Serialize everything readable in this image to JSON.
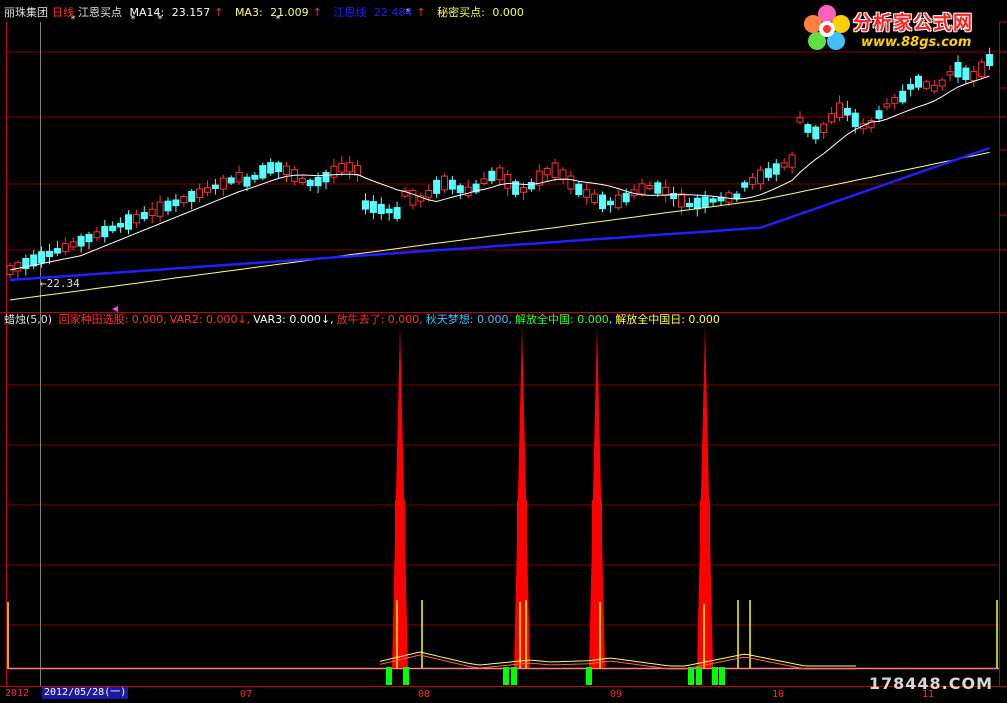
{
  "header": {
    "stock_name": "丽珠集团",
    "period": "日线",
    "indicator": "江恩买点",
    "ma14_label": "MA14:",
    "ma14_value": "23.157",
    "ma14_arrow": "↑",
    "ma3_label": "MA3:",
    "ma3_value": "21.009",
    "ma3_arrow": "↑",
    "gann_label": "江恩线",
    "gann_value": "22.484",
    "gann_arrow": "↑",
    "secret_label": "秘密买点:",
    "secret_value": "0.000"
  },
  "price_panel": {
    "low_marker": "←22.34"
  },
  "sub_panel": {
    "name": "蜡烛(5,0)",
    "items": [
      {
        "label": "回家种田选股:",
        "value": "0.000,",
        "color": "#ff3030"
      },
      {
        "label": "VAR2:",
        "value": "0.000↓,",
        "color": "#ff3030"
      },
      {
        "label": "VAR3:",
        "value": "0.000↓,",
        "color": "#ffffff"
      },
      {
        "label": "放牛去了:",
        "value": "0.000,",
        "color": "#ff3030"
      },
      {
        "label": "秋天梦想:",
        "value": "0.000,",
        "color": "#40c0ff"
      },
      {
        "label": "解放全中国:",
        "value": "0.000,",
        "color": "#30ff30"
      },
      {
        "label": "解放全中国日:",
        "value": "0.000",
        "color": "#ffff40"
      }
    ]
  },
  "timeline": {
    "year_label": "2012",
    "date_box": "2012/05/28(一)",
    "months": [
      "07",
      "08",
      "09",
      "10",
      "11"
    ]
  },
  "logo": {
    "title": "分析家公式网",
    "url": "www.88gs.com"
  },
  "watermark": "178448.COM",
  "colors": {
    "up_candle": "#ff3030",
    "down_candle": "#54ffff",
    "ma_white": "#ffffff",
    "ma_yellow": "#ffff80",
    "ma_blue": "#2020ff",
    "grid": "#800000",
    "spike_red": "#ff0000",
    "signal_green": "#00ff00",
    "signal_yellow": "#ffff00"
  }
}
